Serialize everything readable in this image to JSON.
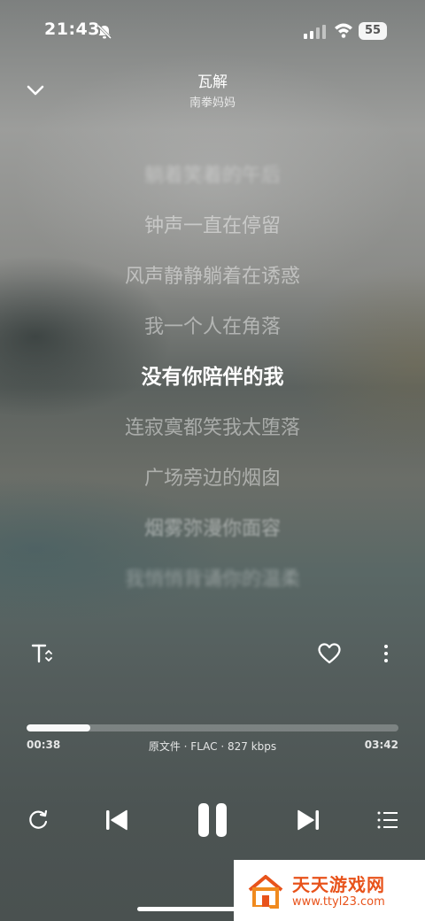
{
  "status_bar": {
    "time": "21:43",
    "battery": "55"
  },
  "header": {
    "title": "瓦解",
    "artist": "南拳妈妈"
  },
  "lyrics": [
    "躺着笑着的午后",
    "钟声一直在停留",
    "风声静静躺着在诱惑",
    "我一个人在角落",
    "没有你陪伴的我",
    "连寂寞都笑我太堕落",
    "广场旁边的烟囱",
    "烟雾弥漫你面容",
    "我悄悄背诵你的温柔"
  ],
  "current_lyric_index": 4,
  "player": {
    "elapsed": "00:38",
    "duration": "03:42",
    "progress_fraction": 0.171,
    "quality": "原文件 · FLAC · 827 kbps"
  },
  "icons": {
    "collapse": "chevron-down-icon",
    "lyric_font": "text-size-icon",
    "like": "heart-icon",
    "more": "more-vertical-icon",
    "repeat": "repeat-icon",
    "previous": "previous-icon",
    "pause": "pause-icon",
    "next": "next-icon",
    "playlist": "playlist-icon"
  },
  "watermark": {
    "name": "天天游戏网",
    "url": "www.ttyl23.com"
  },
  "colors": {
    "accent_watermark": "#e8531b"
  }
}
